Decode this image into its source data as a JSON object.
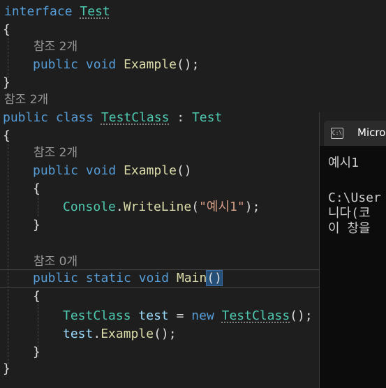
{
  "code": {
    "line1": {
      "kw": "interface",
      "name": "Test"
    },
    "line2": "{",
    "line3": "참조 2개",
    "line4": {
      "kw1": "public",
      "kw2": "void",
      "method": "Example",
      "rest": "();"
    },
    "line5": "}",
    "line6": "참조 2개",
    "line7": {
      "kw1": "public",
      "kw2": "class",
      "name": "TestClass",
      "colon": " : ",
      "base": "Test"
    },
    "line8": "{",
    "line9": "참조 2개",
    "line10": {
      "kw1": "public",
      "kw2": "void",
      "method": "Example",
      "rest": "()"
    },
    "line11": "{",
    "line12": {
      "type": "Console",
      "dot": ".",
      "method": "WriteLine",
      "open": "(",
      "str": "\"예시1\"",
      "close": ");"
    },
    "line13": "}",
    "line14": "참조 0개",
    "line15": {
      "kw1": "public",
      "kw2": "static",
      "kw3": "void",
      "method": "Main",
      "parens": "()"
    },
    "line16": "{",
    "line17": {
      "type": "TestClass",
      "var": "test",
      "eq": " = ",
      "kw": "new",
      "type2": "TestClass",
      "rest": "();"
    },
    "line18": {
      "var": "test",
      "dot": ".",
      "method": "Example",
      "rest": "();"
    },
    "line19": "}",
    "line20": "}"
  },
  "console": {
    "title": "Micros",
    "icon_text": "C:\\",
    "output_line1": "예시1",
    "output_line2": "C:\\User",
    "output_line3": "니다(코",
    "output_line4": "이 창을"
  }
}
